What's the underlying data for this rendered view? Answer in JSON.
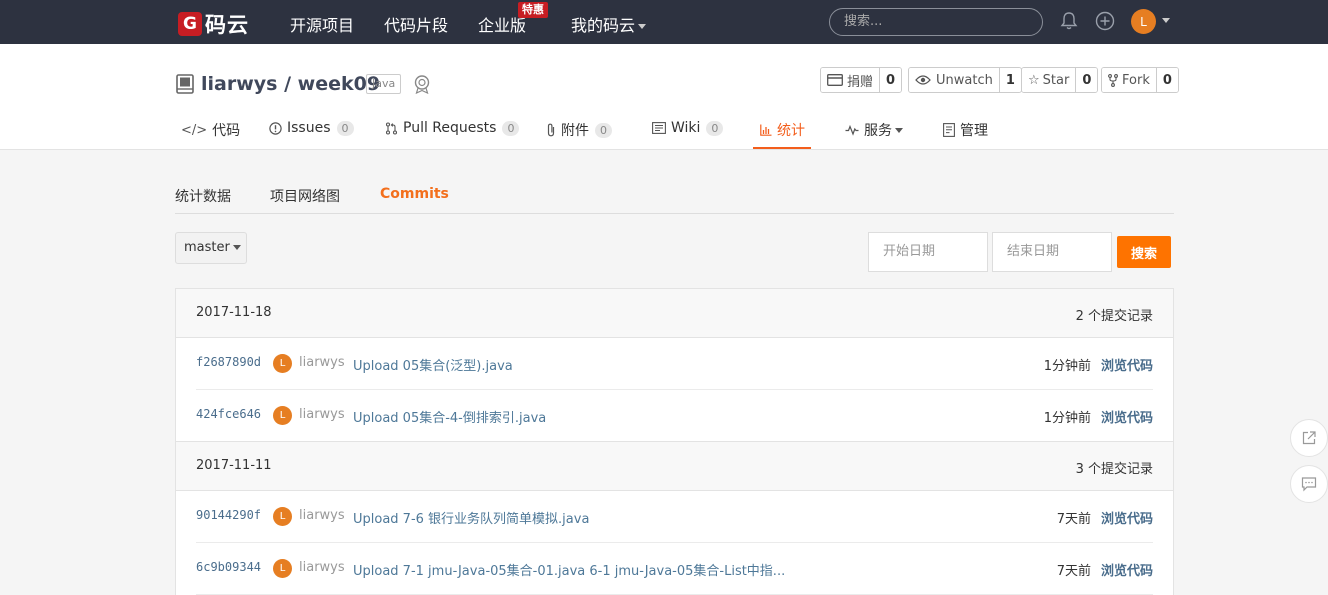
{
  "topnav": {
    "logo_mark": "G",
    "logo_text": "码云",
    "links": [
      "开源项目",
      "代码片段",
      "企业版",
      "我的码云"
    ],
    "special_badge": "特惠",
    "search_placeholder": "搜索...",
    "avatar_initial": "L"
  },
  "repo": {
    "owner": "liarwys",
    "separator": " / ",
    "name": "week09",
    "language": "Java",
    "actions": [
      {
        "label": "捐赠",
        "count": "0",
        "icon": "donate-icon"
      },
      {
        "label": "Unwatch",
        "count": "1",
        "icon": "eye-icon"
      },
      {
        "label": "Star",
        "count": "0",
        "icon": "star-icon"
      },
      {
        "label": "Fork",
        "count": "0",
        "icon": "fork-icon"
      }
    ],
    "tabs": [
      {
        "label": "代码",
        "icon": "code-icon"
      },
      {
        "label": "Issues",
        "count": "0",
        "icon": "issue-icon"
      },
      {
        "label": "Pull Requests",
        "count": "0",
        "icon": "pull-request-icon"
      },
      {
        "label": "附件",
        "count": "0",
        "icon": "attachment-icon"
      },
      {
        "label": "Wiki",
        "count": "0",
        "icon": "wiki-icon"
      },
      {
        "label": "统计",
        "icon": "stats-icon",
        "active": true
      },
      {
        "label": "服务",
        "icon": "pulse-icon"
      },
      {
        "label": "管理",
        "icon": "manage-icon"
      }
    ]
  },
  "stats": {
    "subtabs": [
      "统计数据",
      "项目网络图",
      "Commits"
    ],
    "active_subtab": "Commits",
    "branch": "master",
    "start_date_placeholder": "开始日期",
    "end_date_placeholder": "结束日期",
    "search_label": "搜索"
  },
  "commit_groups": [
    {
      "date": "2017-11-18",
      "count_label": "2 个提交记录",
      "commits": [
        {
          "sha": "f2687890d",
          "avatar": "L",
          "author": "liarwys",
          "message": "Upload 05集合(泛型).java",
          "time": "1分钟前",
          "browse": "浏览代码"
        },
        {
          "sha": "424fce646",
          "avatar": "L",
          "author": "liarwys",
          "message": "Upload 05集合-4-倒排索引.java",
          "time": "1分钟前",
          "browse": "浏览代码"
        }
      ]
    },
    {
      "date": "2017-11-11",
      "count_label": "3 个提交记录",
      "commits": [
        {
          "sha": "90144290f",
          "avatar": "L",
          "author": "liarwys",
          "message": "Upload 7-6 银行业务队列简单模拟.java",
          "time": "7天前",
          "browse": "浏览代码"
        },
        {
          "sha": "6c9b09344",
          "avatar": "L",
          "author": "liarwys",
          "message": "Upload 7-1 jmu-Java-05集合-01.java 6-1 jmu-Java-05集合-List中指...",
          "time": "7天前",
          "browse": "浏览代码"
        }
      ]
    }
  ],
  "colors": {
    "nav_bg": "#2d3240",
    "accent": "#f35e1c",
    "search_button": "#fe7300",
    "link": "#4a6d8c",
    "brand_red": "#c71d23"
  }
}
